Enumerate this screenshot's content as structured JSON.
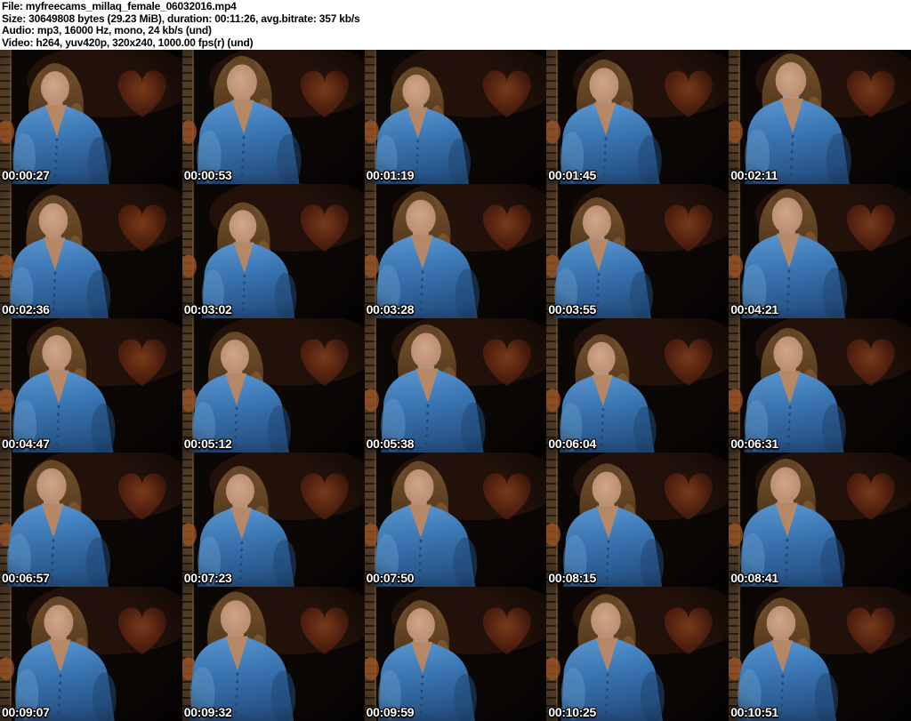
{
  "header": {
    "lines": [
      "File: myfreecams_millaq_female_06032016.mp4",
      "Size: 30649808 bytes (29.23 MiB), duration: 00:11:26, avg.bitrate: 357 kb/s",
      "Audio: mp3, 16000 Hz, mono, 24 kb/s (und)",
      "Video: h264, yuv420p, 320x240, 1000.00 fps(r) (und)"
    ]
  },
  "grid": {
    "columns": 5,
    "rows": 5,
    "thumbnail_source_size": "320x240"
  },
  "thumbnails": [
    "00:00:27",
    "00:00:53",
    "00:01:19",
    "00:01:45",
    "00:02:11",
    "00:02:36",
    "00:03:02",
    "00:03:28",
    "00:03:55",
    "00:04:21",
    "00:04:47",
    "00:05:12",
    "00:05:38",
    "00:06:04",
    "00:06:31",
    "00:06:57",
    "00:07:23",
    "00:07:50",
    "00:08:15",
    "00:08:41",
    "00:09:07",
    "00:09:32",
    "00:09:59",
    "00:10:25",
    "00:10:51"
  ],
  "colors": {
    "header_bg": "#ffffff",
    "header_text": "#000000",
    "scene_dark": "#0b0705",
    "cardigan_blue": "#3c7ab9",
    "heart_red": "#5c2410",
    "wood_brown": "#57402a",
    "timestamp_text": "#ffffff"
  }
}
